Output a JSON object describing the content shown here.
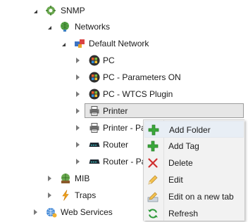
{
  "tree": {
    "snmp": "SNMP",
    "networks": "Networks",
    "default_network": "Default Network",
    "pc": "PC",
    "pc_params": "PC - Parameters ON",
    "pc_wtcs": "PC - WTCS Plugin",
    "printer": "Printer",
    "printer_pa": "Printer - Pa",
    "router": "Router",
    "router_pa": "Router - Pa",
    "mib": "MIB",
    "traps": "Traps",
    "web_services": "Web Services"
  },
  "context_menu": {
    "add_folder": "Add Folder",
    "add_tag": "Add Tag",
    "delete": "Delete",
    "edit": "Edit",
    "edit_new_tab": "Edit on a new tab",
    "refresh": "Refresh"
  },
  "icons": {
    "snmp": "snmp-gear-icon",
    "networks": "network-globe-icon",
    "default_network": "default-network-icon",
    "pc": "pc-windows-icon",
    "printer": "printer-icon",
    "router": "router-icon",
    "mib": "mib-icon",
    "traps": "trap-lightning-icon",
    "web_services": "web-services-icon",
    "add": "plus-icon",
    "delete": "cross-icon",
    "edit": "pencil-icon",
    "edit_new_tab": "pencil-tab-icon",
    "refresh": "refresh-icon"
  },
  "colors": {
    "menu_hover": "#e8eef5",
    "selection_bg": "#e6e6e6",
    "plus_green": "#3aa83a",
    "delete_red": "#d03030"
  }
}
